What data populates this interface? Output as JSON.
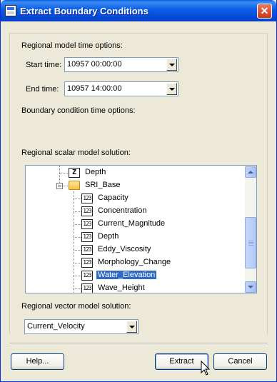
{
  "window": {
    "title": "Extract Boundary Conditions",
    "close_glyph": "✕"
  },
  "regional_time": {
    "heading": "Regional model time options:",
    "start_label": "Start time:",
    "start_value": "10957 00:00:00",
    "end_label": "End time:",
    "end_value": "10957 14:00:00"
  },
  "bc_time": {
    "heading": "Boundary condition time options:"
  },
  "scalar": {
    "heading": "Regional scalar model solution:",
    "tree": [
      {
        "label": "Depth",
        "icon": "z-icon",
        "icon_text": "Z"
      },
      {
        "label": "SRI_Base",
        "icon": "folder-icon"
      },
      {
        "label": "Capacity",
        "icon": "scalar-dataset-icon",
        "icon_text": "123"
      },
      {
        "label": "Concentration",
        "icon": "scalar-dataset-icon",
        "icon_text": "123"
      },
      {
        "label": "Current_Magnitude",
        "icon": "scalar-dataset-icon",
        "icon_text": "123"
      },
      {
        "label": "Depth",
        "icon": "scalar-dataset-icon",
        "icon_text": "123"
      },
      {
        "label": "Eddy_Viscosity",
        "icon": "scalar-dataset-icon",
        "icon_text": "123"
      },
      {
        "label": "Morphology_Change",
        "icon": "scalar-dataset-icon",
        "icon_text": "123"
      },
      {
        "label": "Water_Elevation",
        "icon": "scalar-dataset-icon",
        "icon_text": "123",
        "selected": true
      },
      {
        "label": "Wave_Height",
        "icon": "scalar-dataset-icon",
        "icon_text": "123"
      }
    ]
  },
  "vector": {
    "heading": "Regional vector model solution:",
    "selected": "Current_Velocity"
  },
  "buttons": {
    "help": "Help...",
    "extract": "Extract",
    "cancel": "Cancel"
  }
}
